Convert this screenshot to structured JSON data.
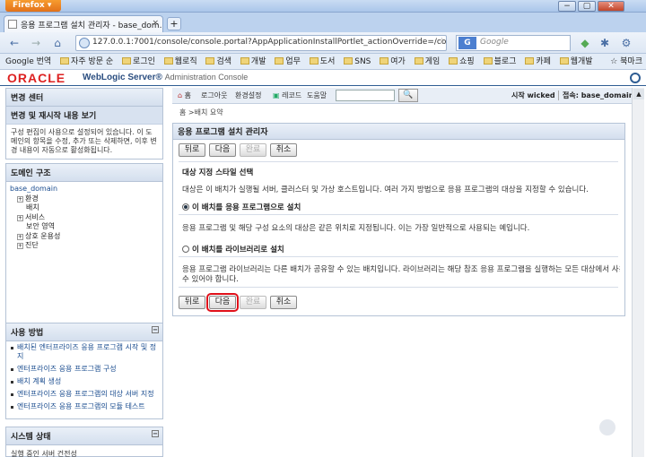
{
  "browser": {
    "menu_label": "Firefox",
    "tab_title": "응용 프로그램 설치 관리자 - base_dom...",
    "tab_close": "×",
    "new_tab": "+",
    "url": "127.0.0.1:7001/console/console.portal?AppApplicationInstallPortlet_actionOverride=/com/bea",
    "search_placeholder": "Google",
    "search_engine": "G",
    "bookmarks": [
      "Google 번역",
      "자주 방문 순",
      "로그인",
      "웹로직",
      "검색",
      "개발",
      "업무",
      "도서",
      "SNS",
      "여가",
      "게임",
      "쇼핑",
      "블로그",
      "카페",
      "웹개발"
    ],
    "bookmarks_menu": "북마크",
    "window_controls": [
      "−",
      "▢",
      "✕"
    ]
  },
  "console": {
    "brand": "ORACLE",
    "product": "WebLogic Server®",
    "product_sub": "Administration Console",
    "topnav": {
      "home": "홈",
      "logout": "로그아웃",
      "preferences": "환경설정",
      "record": "레코드",
      "help": "도움말",
      "search_button": "🔍",
      "welcome": "시작 wicked",
      "connected": "접속: base_domain"
    },
    "breadcrumb": "홈 >배치 요약"
  },
  "change_center": {
    "title": "변경 센터",
    "view_link": "변경 및 재시작 내용 보기",
    "message": "구성 편집이 사용으로 설정되어 있습니다. 이 도메인의 항목을 수정, 추가 또는 삭제하면, 이후 변경 내용이 자동으로 활성화됩니다."
  },
  "domain_structure": {
    "title": "도메인 구조",
    "root": "base_domain",
    "nodes": [
      {
        "label": "환경",
        "expander": "+"
      },
      {
        "label": "배치",
        "expander": ""
      },
      {
        "label": "서비스",
        "expander": "+"
      },
      {
        "label": "보안 영역",
        "expander": ""
      },
      {
        "label": "상호 운용성",
        "expander": "+"
      },
      {
        "label": "진단",
        "expander": "+"
      }
    ]
  },
  "how_do_i": {
    "title": "사용 방법",
    "items": [
      "배치된 엔터프라이즈 응용 프로그램 시작 및 정지",
      "엔터프라이즈 응용 프로그램 구성",
      "배치 계획 생성",
      "엔터프라이즈 응용 프로그램의 대상 서버 지정",
      "엔터프라이즈 응용 프로그램의 모듈 테스트"
    ]
  },
  "system_status": {
    "title": "시스템 상태",
    "row": "실행 중인 서버 건전성"
  },
  "assistant": {
    "title": "응용 프로그램 설치 관리자",
    "buttons": {
      "back": "뒤로",
      "next": "다음",
      "finish": "완료",
      "cancel": "취소"
    },
    "section_title": "대상 지정 스타일 선택",
    "section_desc": "대상은 이 배치가 실행될 서버, 클러스터 및 가상 호스트입니다. 여러 가지 방법으로 응용 프로그램의 대상을 지정할 수 있습니다.",
    "option_app": "이 배치를 응용 프로그램으로 설치",
    "option_app_desc": "응용 프로그램 및 해당 구성 요소의 대상은 같은 위치로 지정됩니다. 이는 가장 일반적으로 사용되는 예입니다.",
    "option_lib": "이 배치를 라이브러리로 설치",
    "option_lib_desc1": "응용 프로그램 라이브러리는 다른 배치가 공유할 수 있는 배치입니다. 라이브러리는 해당 참조 응용 프로그램을 실행하는 모든 대상에서 사용할",
    "option_lib_desc2": "수 있어야 합니다."
  }
}
